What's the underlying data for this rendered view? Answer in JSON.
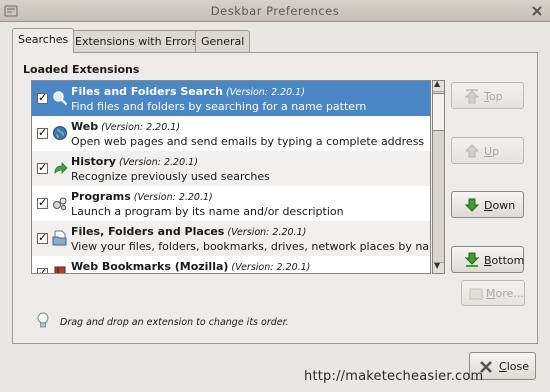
{
  "window": {
    "title": "Deskbar Preferences",
    "close_icon": "close-icon",
    "app_icon": "preferences-icon"
  },
  "tabs": [
    {
      "label": "Searches",
      "active": true
    },
    {
      "label": "Extensions with Errors",
      "active": false
    },
    {
      "label": "General",
      "active": false
    }
  ],
  "section_label": "Loaded Extensions",
  "extensions": [
    {
      "name": "Files and Folders Search",
      "version": "(Version: 2.20.1)",
      "description": "Find files and folders by searching for a name pattern",
      "checked": true,
      "icon": "search-icon",
      "selected": true
    },
    {
      "name": "Web",
      "version": "(Version: 2.20.1)",
      "description": "Open web pages and send emails by typing a complete address",
      "checked": true,
      "icon": "globe-icon",
      "selected": false
    },
    {
      "name": "History",
      "version": "(Version: 2.20.1)",
      "description": "Recognize previously used searches",
      "checked": true,
      "icon": "history-arrow-icon",
      "selected": false
    },
    {
      "name": "Programs",
      "version": "(Version: 2.20.1)",
      "description": "Launch a program by its name and/or description",
      "checked": true,
      "icon": "programs-gears-icon",
      "selected": false
    },
    {
      "name": "Files, Folders and Places",
      "version": "(Version: 2.20.1)",
      "description": "View your files, folders, bookmarks, drives, network places by name",
      "checked": true,
      "icon": "file-folder-icon",
      "selected": false
    },
    {
      "name": "Web Bookmarks (Mozilla)",
      "version": "(Version: 2.20.1)",
      "description": "",
      "checked": true,
      "icon": "bookmarks-book-icon",
      "selected": false
    }
  ],
  "buttons": {
    "top": {
      "label_pre": "",
      "mnemonic": "T",
      "label_post": "op",
      "enabled": false
    },
    "up": {
      "label_pre": "",
      "mnemonic": "U",
      "label_post": "p",
      "enabled": false
    },
    "down": {
      "label_pre": "",
      "mnemonic": "D",
      "label_post": "own",
      "enabled": true
    },
    "bottom": {
      "label_pre": "",
      "mnemonic": "B",
      "label_post": "ottom",
      "enabled": true
    },
    "more": {
      "label_pre": "",
      "mnemonic": "M",
      "label_post": "ore...",
      "enabled": false
    },
    "close": {
      "label_pre": "",
      "mnemonic": "C",
      "label_post": "lose",
      "enabled": true
    }
  },
  "hint": "Drag and drop an extension to change its order.",
  "watermark": "http://maketecheasier.com",
  "colors": {
    "selection": "#4b86c6",
    "arrow_green": "#3f9c2f"
  }
}
